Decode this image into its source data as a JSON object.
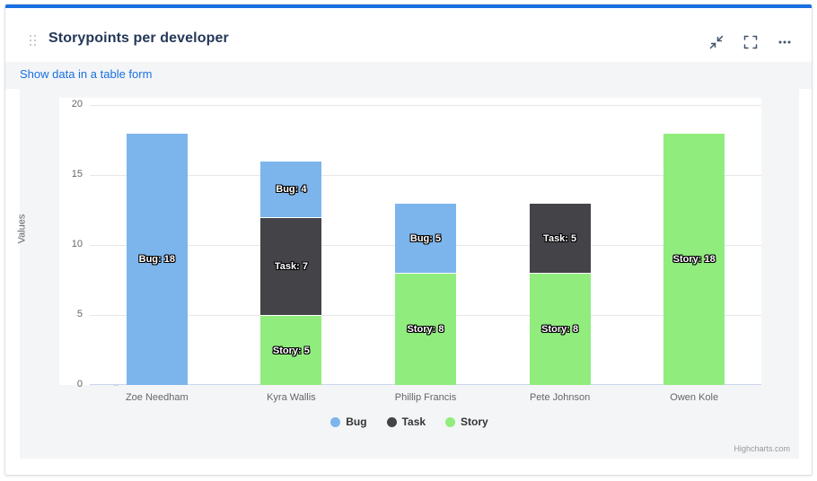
{
  "card": {
    "title": "Storypoints per developer",
    "accent_color": "#1a70e0",
    "drag_handle_icon": "drag-dots-icon"
  },
  "header_actions": [
    {
      "name": "collapse-icon",
      "label": "Collapse"
    },
    {
      "name": "fullscreen-icon",
      "label": "Fullscreen"
    },
    {
      "name": "more-options-icon",
      "label": "More options"
    }
  ],
  "toolbar": {
    "table_link_label": "Show data in a table form"
  },
  "chart_data": {
    "type": "bar",
    "stacked": true,
    "title": "",
    "subtitle": "",
    "xlabel": "",
    "ylabel": "Values",
    "categories": [
      "Zoe Needham",
      "Kyra Wallis",
      "Phillip Francis",
      "Pete Johnson",
      "Owen Kole"
    ],
    "ylim": [
      0,
      20
    ],
    "yticks": [
      0,
      5,
      10,
      15,
      20
    ],
    "grid": true,
    "legend_position": "bottom",
    "series": [
      {
        "name": "Bug",
        "color": "#7cb5ec",
        "values": [
          18,
          4,
          5,
          0,
          0
        ]
      },
      {
        "name": "Task",
        "color": "#434348",
        "values": [
          0,
          7,
          0,
          5,
          0
        ]
      },
      {
        "name": "Story",
        "color": "#90ed7d",
        "values": [
          0,
          5,
          8,
          8,
          18
        ]
      }
    ],
    "point_labels": [
      [
        {
          "series": "Bug",
          "text": "Bug: 18"
        }
      ],
      [
        {
          "series": "Bug",
          "text": "Bug: 4"
        },
        {
          "series": "Task",
          "text": "Task: 7"
        },
        {
          "series": "Story",
          "text": "Story: 5"
        }
      ],
      [
        {
          "series": "Bug",
          "text": "Bug: 5"
        },
        {
          "series": "Story",
          "text": "Story: 8"
        }
      ],
      [
        {
          "series": "Task",
          "text": "Task: 5"
        },
        {
          "series": "Story",
          "text": "Story: 8"
        }
      ],
      [
        {
          "series": "Story",
          "text": "Story: 18"
        }
      ]
    ],
    "credits": "Highcharts.com"
  }
}
